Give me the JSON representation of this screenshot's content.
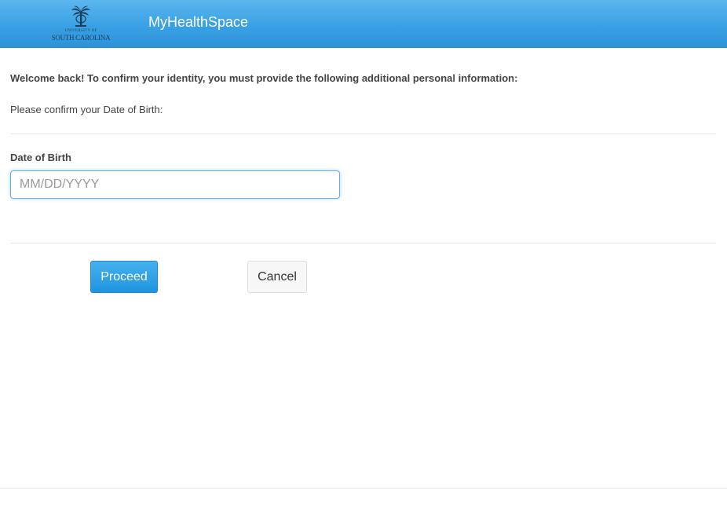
{
  "header": {
    "logo": {
      "icon": "university-seal-icon",
      "line1": "UNIVERSITY OF",
      "line2": "SOUTH CAROLINA"
    },
    "app_title": "MyHealthSpace",
    "colors": {
      "bar_top": "#5bb6ee",
      "bar_bottom": "#2c93d9",
      "title_text": "#ffffff"
    }
  },
  "main": {
    "welcome_text": "Welcome back! To confirm your identity, you must provide the following additional personal information:",
    "confirm_text": "Please confirm your Date of Birth:",
    "dob": {
      "label": "Date of Birth",
      "value": "",
      "placeholder": "MM/DD/YYYY"
    },
    "buttons": {
      "proceed_label": "Proceed",
      "cancel_label": "Cancel"
    },
    "colors": {
      "primary": "#1f95e0",
      "focus_border": "#66afe9"
    }
  }
}
